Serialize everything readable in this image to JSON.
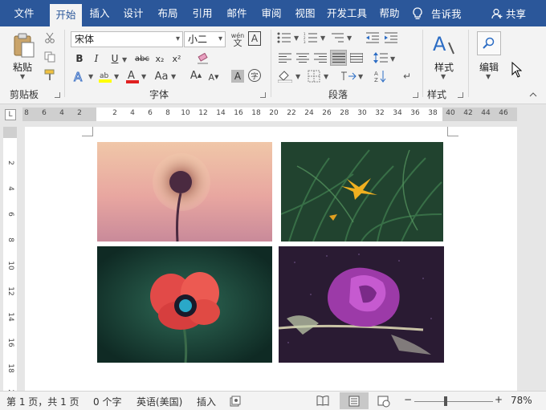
{
  "tabs": [
    "文件",
    "开始",
    "插入",
    "设计",
    "布局",
    "引用",
    "邮件",
    "审阅",
    "视图",
    "开发工具",
    "帮助"
  ],
  "tell_me": "告诉我",
  "share": "共享",
  "clipboard": {
    "paste": "粘贴",
    "label": "剪贴板"
  },
  "font": {
    "name": "宋体",
    "size": "小二",
    "label": "字体",
    "bold": "B",
    "italic": "I",
    "underline": "U",
    "strike": "abc",
    "sub": "x₂",
    "sup": "x²",
    "case": "Aa",
    "grow": "A",
    "shrink": "A",
    "wen": "wén",
    "wen_char": "文"
  },
  "paragraph": {
    "label": "段落"
  },
  "styles": {
    "label": "样式",
    "button": "样式"
  },
  "editing": {
    "button": "编辑"
  },
  "ruler": {
    "numbers": [
      "8",
      "6",
      "4",
      "2",
      "",
      "2",
      "4",
      "6",
      "8",
      "10",
      "12",
      "14",
      "16",
      "18",
      "20",
      "22",
      "24",
      "26",
      "28",
      "30",
      "32",
      "34",
      "36",
      "38",
      "40",
      "42",
      "44",
      "46"
    ],
    "vertical": [
      "2",
      "4",
      "6",
      "8",
      "10",
      "12",
      "14",
      "16",
      "18",
      "20"
    ],
    "corner": "L"
  },
  "status": {
    "page": "第 1 页，共 1 页",
    "words": "0 个字",
    "language": "英语(美国)",
    "insert": "插入",
    "zoom": "78%",
    "zoom_level": 0.4
  }
}
